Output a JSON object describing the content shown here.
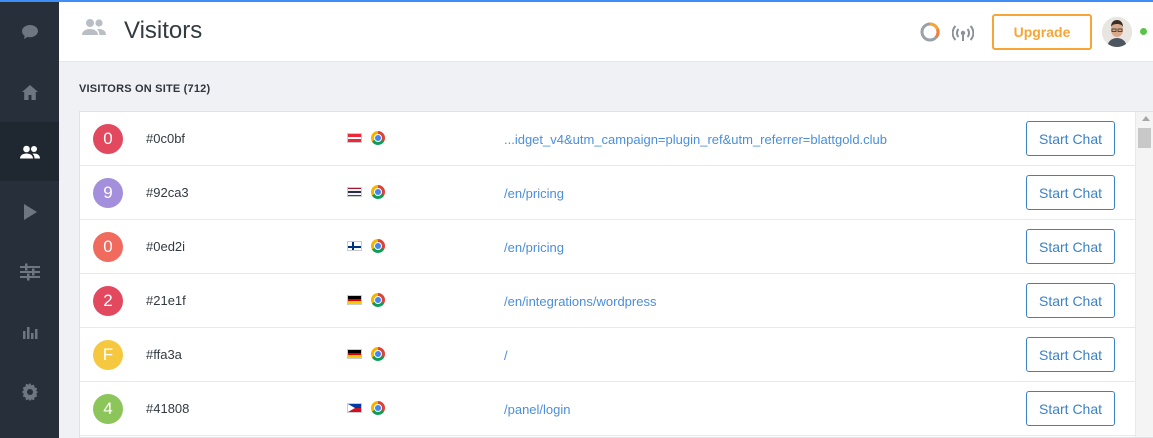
{
  "header": {
    "title": "Visitors",
    "upgrade_label": "Upgrade"
  },
  "sidebar": {
    "items": [
      {
        "icon": "chat-bubble-icon",
        "active": false
      },
      {
        "icon": "home-icon",
        "active": false
      },
      {
        "icon": "users-icon",
        "active": true
      },
      {
        "icon": "play-icon",
        "active": false
      },
      {
        "icon": "sliders-icon",
        "active": false
      },
      {
        "icon": "bar-chart-icon",
        "active": false
      },
      {
        "icon": "gear-icon",
        "active": false
      }
    ]
  },
  "section": {
    "label": "VISITORS ON SITE (712)"
  },
  "visitors": [
    {
      "initial": "0",
      "color": "#e3495e",
      "id": "#0c0bf",
      "flag": "austria",
      "url": "...idget_v4&utm_campaign=plugin_ref&utm_referrer=blattgold.club",
      "action": "Start Chat"
    },
    {
      "initial": "9",
      "color": "#a48fdc",
      "id": "#92ca3",
      "flag": "thailand",
      "url": "/en/pricing",
      "action": "Start Chat"
    },
    {
      "initial": "0",
      "color": "#f06a5e",
      "id": "#0ed2i",
      "flag": "finland",
      "url": "/en/pricing",
      "action": "Start Chat"
    },
    {
      "initial": "2",
      "color": "#e3495e",
      "id": "#21e1f",
      "flag": "germany",
      "url": "/en/integrations/wordpress",
      "action": "Start Chat"
    },
    {
      "initial": "F",
      "color": "#f6c840",
      "id": "#ffa3a",
      "flag": "germany",
      "url": "/",
      "action": "Start Chat"
    },
    {
      "initial": "4",
      "color": "#8cc55a",
      "id": "#41808",
      "flag": "philippines",
      "url": "/panel/login",
      "action": "Start Chat"
    }
  ],
  "colors": {
    "accent": "#3f8ef5",
    "upgrade": "#f5a637",
    "online": "#5cc24c",
    "link": "#4a8fd9"
  }
}
